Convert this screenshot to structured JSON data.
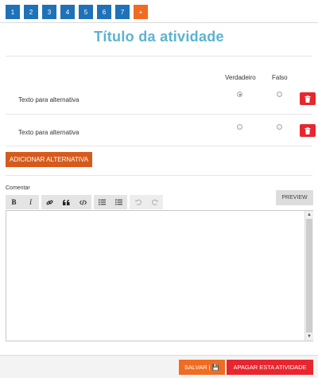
{
  "tabs": [
    {
      "label": "1"
    },
    {
      "label": "2"
    },
    {
      "label": "3"
    },
    {
      "label": "4"
    },
    {
      "label": "5"
    },
    {
      "label": "6"
    },
    {
      "label": "7"
    }
  ],
  "add_tab_label": "+",
  "title": "Título da atividade",
  "columns": {
    "true_label": "Verdadeiro",
    "false_label": "Falso"
  },
  "alternatives": [
    {
      "text": "Texto para alternativa",
      "true_checked": true,
      "false_checked": false
    },
    {
      "text": "Texto para alternativa",
      "true_checked": false,
      "false_checked": false
    }
  ],
  "add_alternative_label": "ADICIONAR ALTERNATIVA",
  "comment": {
    "label": "Comentar",
    "preview_label": "PREVIEW",
    "value": "",
    "toolbar": {
      "bold": "B",
      "italic": "I",
      "link_icon": "link-icon",
      "quote_icon": "quote-icon",
      "code_icon": "code-icon",
      "ordered_list_icon": "ordered-list-icon",
      "unordered_list_icon": "unordered-list-icon",
      "undo_icon": "undo-icon",
      "redo_icon": "redo-icon"
    }
  },
  "footer": {
    "save_label": "SALVAR | 💾",
    "delete_label": "APAGAR ESTA ATIVIDADE"
  },
  "colors": {
    "tab": "#1f71b8",
    "add_tab": "#ef6c22",
    "title": "#5ab3d3",
    "delete": "#e8262f",
    "add_alternative": "#d55b1c",
    "save": "#ef6c22"
  }
}
